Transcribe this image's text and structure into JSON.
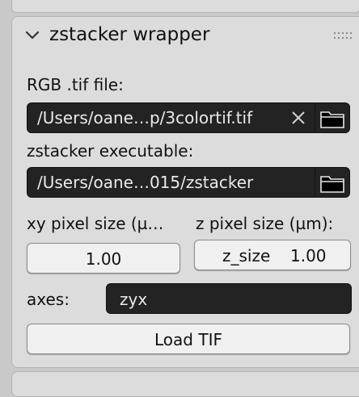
{
  "panel": {
    "title": "zstacker wrapper",
    "collapse_icon": "chevron-down-icon",
    "drag_icon": "grip-dots-icon"
  },
  "rgb_tif": {
    "label": "RGB .tif file:",
    "value": "/Users/oane…p/3colortif.tif",
    "clear_icon": "close-icon",
    "browse_icon": "folder-icon"
  },
  "executable": {
    "label": "zstacker executable:",
    "value": "/Users/oane…015/zstacker",
    "browse_icon": "folder-icon"
  },
  "xy_pixel": {
    "label": "xy pixel size (µ…",
    "value": "1.00"
  },
  "z_pixel": {
    "label": "z pixel size (µm):",
    "field_name": "z_size",
    "value": "1.00"
  },
  "axes": {
    "label": "axes:",
    "value": "zyx"
  },
  "load_button": {
    "label": "Load TIF"
  },
  "colors": {
    "panel_bg": "#dcdcdc",
    "field_dark": "#232323",
    "button_light": "#f0f0f0"
  }
}
